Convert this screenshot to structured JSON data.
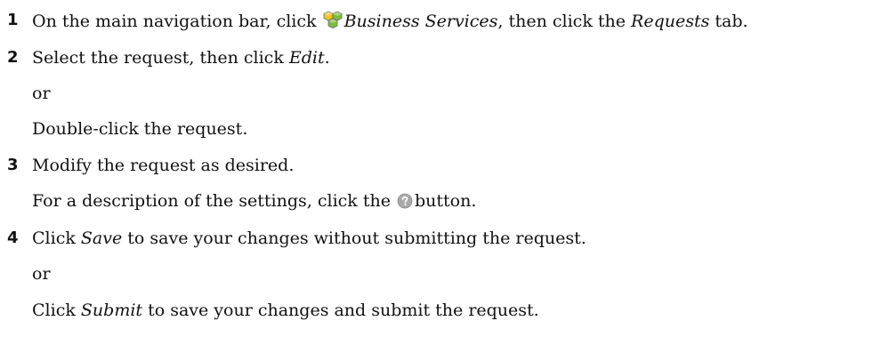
{
  "steps": [
    {
      "number": "1",
      "parts": {
        "t1": "On the main navigation bar, click",
        "t2": "Business Services",
        "t3": ", then click the",
        "t4": "Requests",
        "t5": " tab."
      }
    },
    {
      "number": "2",
      "parts": {
        "t1": "Select the request, then click",
        "t2": "Edit",
        "t3": "."
      },
      "or": "or",
      "alt": "Double-click the request."
    },
    {
      "number": "3",
      "text": "Modify the request as desired.",
      "note": {
        "t1": "For a description of the settings, click the",
        "t2": "button."
      }
    },
    {
      "number": "4",
      "parts": {
        "t1": "Click",
        "t2": "Save",
        "t3": " to save your changes without submitting the request."
      },
      "or": "or",
      "alt": {
        "t1": "Click",
        "t2": "Submit",
        "t3": " to save your changes and submit the request."
      }
    }
  ],
  "icons": {
    "business_services": "cubes-icon",
    "help": "help-icon"
  },
  "colors": {
    "cube_green": "#7cbf3a",
    "cube_yellow": "#f0c419",
    "cube_outline": "#6a6a6a",
    "help_gray": "#a9a9a9"
  }
}
